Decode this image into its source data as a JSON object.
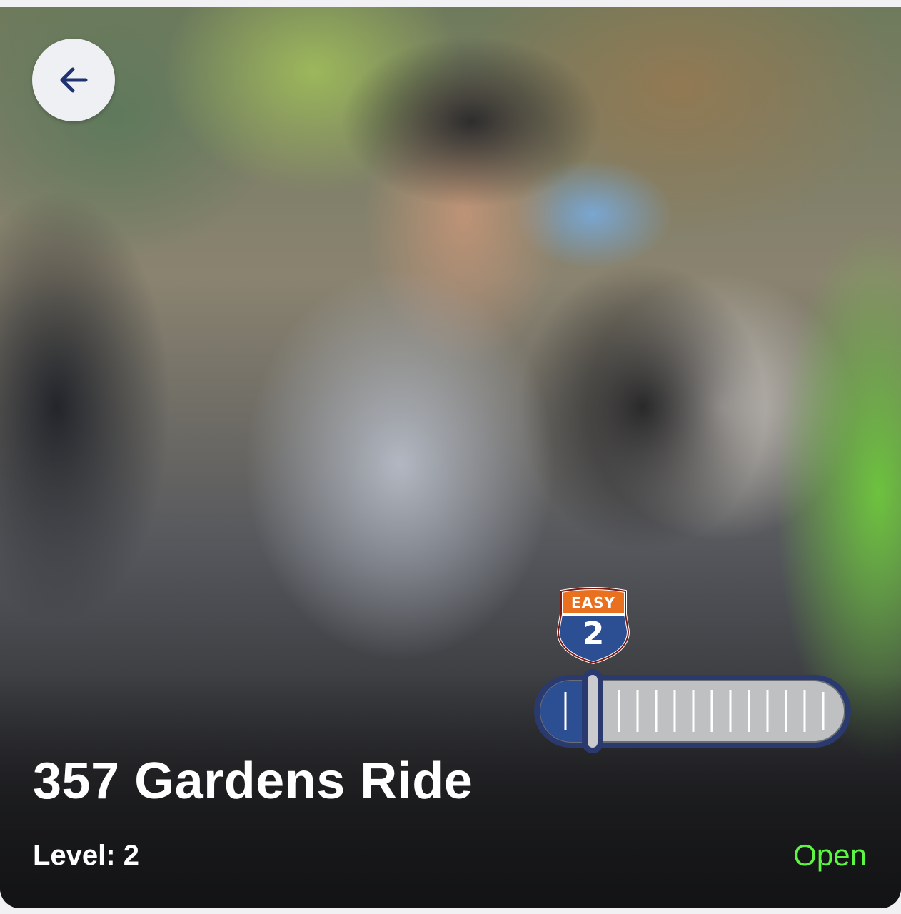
{
  "ride": {
    "title": "357 Gardens Ride",
    "level_label": "Level:",
    "level_value": "2",
    "status": "Open"
  },
  "difficulty_badge": {
    "word": "EASY",
    "number": "2",
    "level_fraction": 0.05
  },
  "icons": {
    "back": "arrow-left-icon"
  },
  "colors": {
    "status_open": "#5cf542",
    "badge_blue": "#2c4f93",
    "badge_orange": "#e8701e",
    "back_arrow": "#1f3370"
  }
}
